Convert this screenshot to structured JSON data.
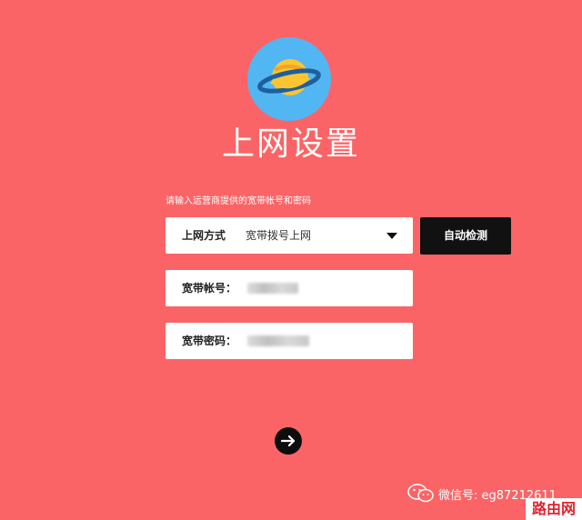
{
  "page": {
    "title": "上网设置"
  },
  "form": {
    "hint": "请输入运营商提供的宽带帐号和密码",
    "connection_type": {
      "label": "上网方式",
      "selected": "宽带拨号上网"
    },
    "detect_button": "自动检测",
    "account": {
      "label": "宽带帐号："
    },
    "password": {
      "label": "宽带密码："
    }
  },
  "icons": {
    "logo": "planet-icon",
    "dropdown": "caret-down-icon",
    "next": "arrow-right-icon",
    "wechat": "wechat-icon"
  },
  "watermark": {
    "text": "微信号: eg87212611",
    "site": "路由网"
  },
  "colors": {
    "background": "#fb6466",
    "button": "#111111",
    "logo_circle": "#52b6f2",
    "planet": "#fbc531"
  }
}
